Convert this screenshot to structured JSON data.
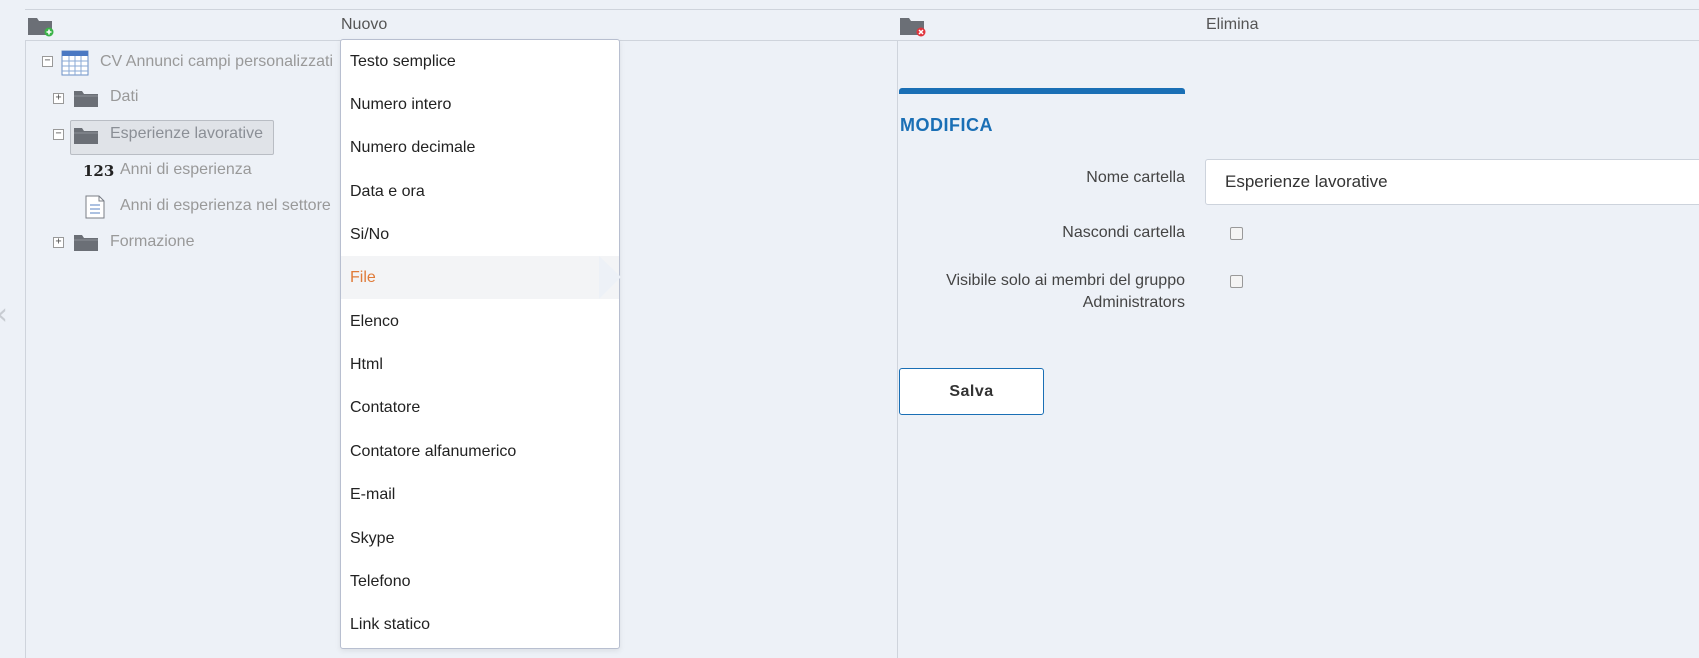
{
  "toolbar": {
    "new_label": "Nuovo",
    "delete_label": "Elimina"
  },
  "tree": {
    "root": "CV Annunci campi personalizzati",
    "nodes": [
      {
        "label": "Dati",
        "expanded": false
      },
      {
        "label": "Esperienze lavorative",
        "expanded": true,
        "selected": true
      },
      {
        "label": "Anni di esperienza",
        "child": true,
        "icon": "number-field-icon",
        "icon_text": "123"
      },
      {
        "label": "Anni di esperienza nel settore",
        "child": true,
        "icon": "document-field-icon"
      },
      {
        "label": "Formazione",
        "expanded": false
      }
    ]
  },
  "menu": {
    "items": [
      "Testo semplice",
      "Numero intero",
      "Numero decimale",
      "Data e ora",
      "Si/No",
      "File",
      "Elenco",
      "Html",
      "Contatore",
      "Contatore alfanumerico",
      "E-mail",
      "Skype",
      "Telefono",
      "Link statico"
    ],
    "active_index": 5
  },
  "form": {
    "title": "MODIFICA",
    "folder_name_label": "Nome cartella",
    "folder_name_value": "Esperienze lavorative",
    "hide_folder_label": "Nascondi cartella",
    "visible_only_label_1": "Visibile solo ai membri del gruppo",
    "visible_only_label_2": "Administrators",
    "save_label": "Salva"
  },
  "colors": {
    "accent": "#1a6fb5",
    "active_menu_text": "#e07b39",
    "background": "#edf1f7"
  }
}
